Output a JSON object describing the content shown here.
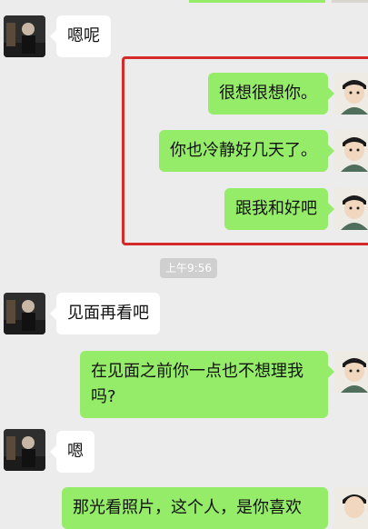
{
  "time_divider": "上午9:56",
  "messages": [
    {
      "side": "left",
      "text": "嗯呢"
    },
    {
      "side": "right",
      "text": "很想很想你。"
    },
    {
      "side": "right",
      "text": "你也冷静好几天了。"
    },
    {
      "side": "right",
      "text": "跟我和好吧"
    },
    {
      "side": "left",
      "text": "见面再看吧"
    },
    {
      "side": "right",
      "text": "在见面之前你一点也不想理我吗?"
    },
    {
      "side": "left",
      "text": "嗯"
    },
    {
      "side": "right",
      "text": "那光看照片，这个人，是你喜欢"
    }
  ],
  "colors": {
    "background": "#ececec",
    "sent_bubble": "#95ec69",
    "received_bubble": "#ffffff",
    "highlight": "#d42a2a"
  }
}
